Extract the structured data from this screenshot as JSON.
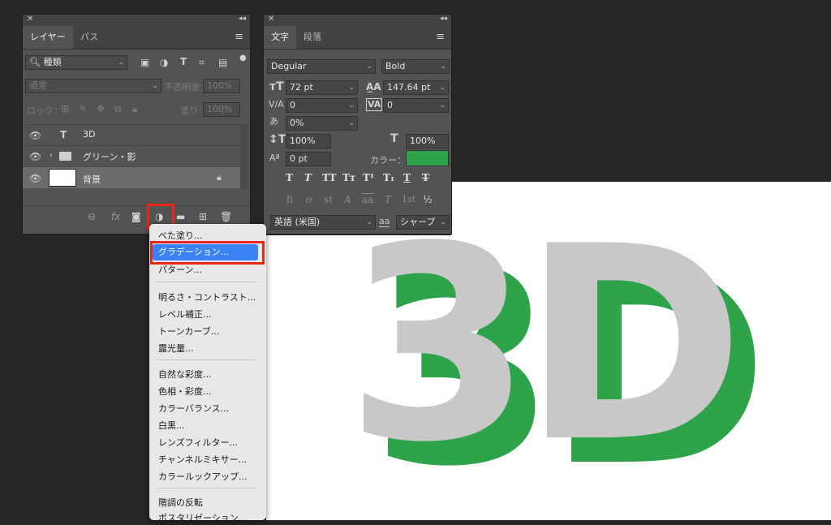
{
  "layers_panel": {
    "tabs": [
      "レイヤー",
      "パス"
    ],
    "filter_label": "種類",
    "blend_mode": "通常",
    "opacity_label": "不透明度：",
    "opacity_value": "100%",
    "lock_label": "ロック：",
    "fill_label": "塗り：",
    "fill_value": "100%",
    "layers": [
      {
        "name": "3D",
        "type": "text"
      },
      {
        "name": "グリーン・影",
        "type": "group"
      },
      {
        "name": "背景",
        "type": "background"
      }
    ],
    "bottom_icons": [
      "link-icon",
      "fx-icon",
      "mask-icon",
      "adjustment-icon",
      "folder-icon",
      "new-layer-icon",
      "trash-icon"
    ]
  },
  "character_panel": {
    "tabs": [
      "文字",
      "段落"
    ],
    "font_family": "Degular",
    "font_style": "Bold",
    "font_size": "72 pt",
    "leading": "147.64 pt",
    "kerning": "0",
    "tracking": "0",
    "tsume": "0%",
    "vertical_scale": "100%",
    "horizontal_scale": "100%",
    "color_label": "カラー：",
    "color_value": "#2ea34a",
    "style_buttons_row1": [
      "T",
      "T",
      "TT",
      "Tт",
      "T¹",
      "T₁",
      "T",
      "T"
    ],
    "style_buttons_row2": [
      "ﬁ",
      "ơ",
      "st",
      "A",
      "aa",
      "T",
      "1st",
      "½"
    ],
    "language": "英語 (米国)",
    "aa_label": "aa",
    "antialias": "シャープ"
  },
  "adjustment_menu": {
    "items_group1": [
      "べた塗り...",
      "グラデーション...",
      "パターン..."
    ],
    "items_group2": [
      "明るさ・コントラスト...",
      "レベル補正...",
      "トーンカーブ...",
      "露光量..."
    ],
    "items_group3": [
      "自然な彩度...",
      "色相・彩度...",
      "カラーバランス...",
      "白黒...",
      "レンズフィルター...",
      "チャンネルミキサー...",
      "カラールックアップ..."
    ],
    "items_group4": [
      "階調の反転",
      "ポスタリゼーション..."
    ],
    "highlighted": "グラデーション..."
  },
  "canvas": {
    "text": "3D",
    "front_color": "#c8c8c8",
    "shadow_color": "#2ea34a"
  }
}
